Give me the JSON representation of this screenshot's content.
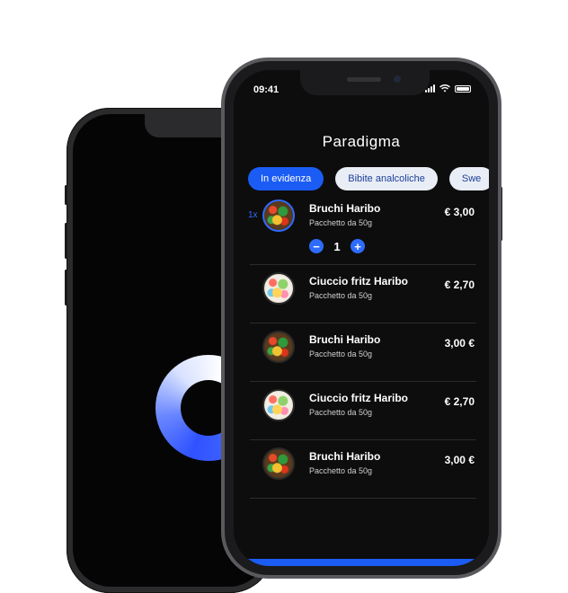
{
  "status": {
    "time": "09:41"
  },
  "header": {
    "title": "Paradigma"
  },
  "tabs": [
    {
      "label": "In evidenza",
      "active": true
    },
    {
      "label": "Bibite analcoliche",
      "active": false
    },
    {
      "label": "Swe",
      "active": false
    }
  ],
  "products": [
    {
      "name": "Bruchi Haribo",
      "subtitle": "Pacchetto da 50g",
      "price": "€ 3,00",
      "qty_prefix": "1x",
      "quantity": "1",
      "selected": true,
      "thumb": "dark"
    },
    {
      "name": "Ciuccio fritz Haribo",
      "subtitle": "Pacchetto da 50g",
      "price": "€ 2,70",
      "thumb": "light"
    },
    {
      "name": "Bruchi Haribo",
      "subtitle": "Pacchetto da 50g",
      "price": "3,00 €",
      "thumb": "dark"
    },
    {
      "name": "Ciuccio fritz Haribo",
      "subtitle": "Pacchetto da 50g",
      "price": "€ 2,70",
      "thumb": "light"
    },
    {
      "name": "Bruchi Haribo",
      "subtitle": "Pacchetto da 50g",
      "price": "3,00 €",
      "thumb": "dark"
    }
  ],
  "stepper": {
    "minus": "−",
    "plus": "+"
  },
  "colors": {
    "accent": "#1b5cf4",
    "background": "#0d0d0d",
    "chip": "#e9edf5"
  }
}
